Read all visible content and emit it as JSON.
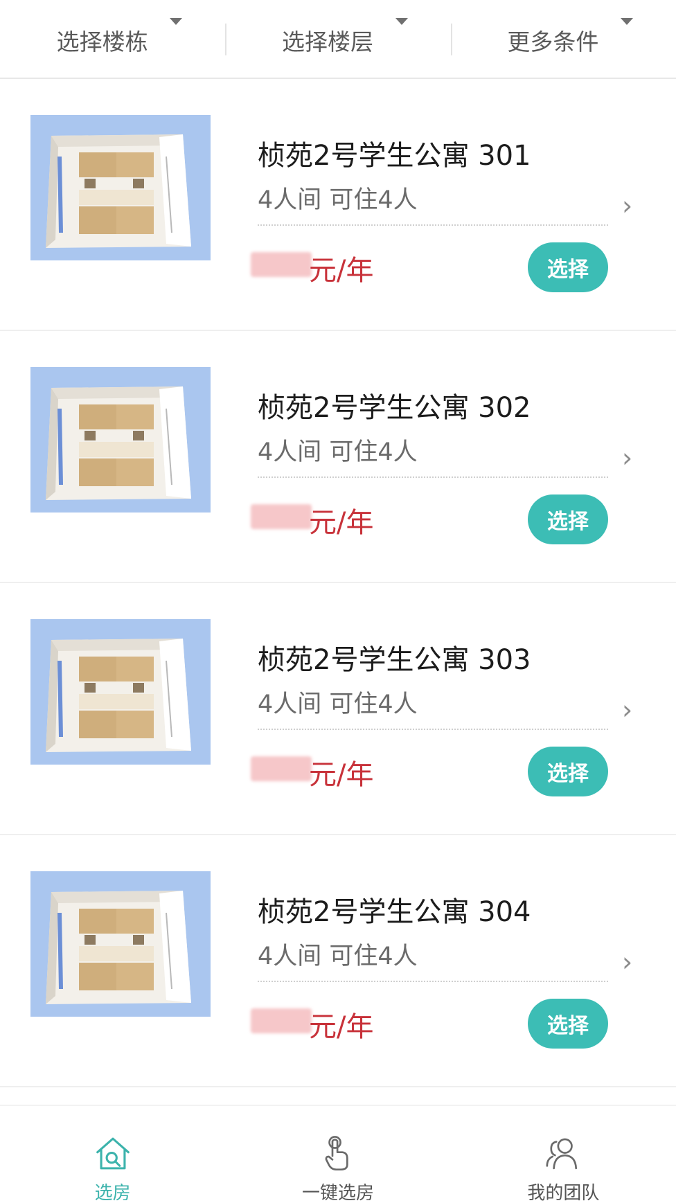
{
  "filters": [
    {
      "label": "选择楼栋"
    },
    {
      "label": "选择楼层"
    },
    {
      "label": "更多条件"
    }
  ],
  "rooms": [
    {
      "name": "桢苑2号学生公寓 301",
      "type": "4人间 可住4人",
      "price_unit": "元/年",
      "action": "选择"
    },
    {
      "name": "桢苑2号学生公寓 302",
      "type": "4人间 可住4人",
      "price_unit": "元/年",
      "action": "选择"
    },
    {
      "name": "桢苑2号学生公寓 303",
      "type": "4人间 可住4人",
      "price_unit": "元/年",
      "action": "选择"
    },
    {
      "name": "桢苑2号学生公寓 304",
      "type": "4人间 可住4人",
      "price_unit": "元/年",
      "action": "选择"
    }
  ],
  "tabs": [
    {
      "label": "选房",
      "icon": "house-search-icon",
      "active": true
    },
    {
      "label": "一键选房",
      "icon": "tap-hand-icon",
      "active": false
    },
    {
      "label": "我的团队",
      "icon": "team-icon",
      "active": false
    }
  ],
  "colors": {
    "accent": "#3cbdb5",
    "price": "#c8323a",
    "active_tab": "#3cb3ac"
  }
}
